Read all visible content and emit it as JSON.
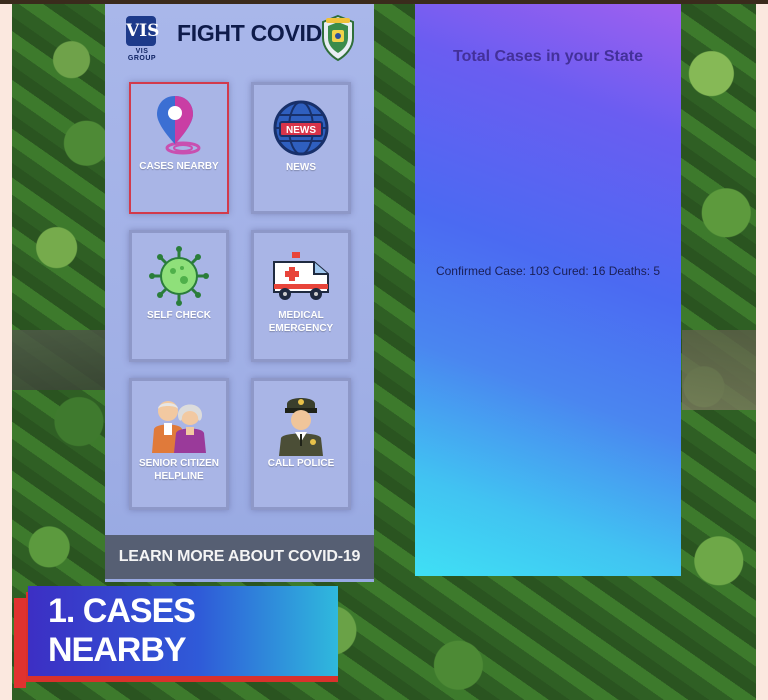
{
  "app": {
    "title": "FIGHT COVID",
    "logo_text": "VIS",
    "logo_sub": "VIS GROUP"
  },
  "tiles": [
    {
      "label": "CASES NEARBY",
      "icon": "location-pin-icon",
      "selected": true
    },
    {
      "label": "NEWS",
      "icon": "news-globe-icon",
      "selected": false
    },
    {
      "label": "SELF CHECK",
      "icon": "virus-icon",
      "selected": false
    },
    {
      "label": "MEDICAL EMERGENCY",
      "icon": "ambulance-icon",
      "selected": false
    },
    {
      "label": "SENIOR CITIZEN HELPLINE",
      "icon": "elderly-couple-icon",
      "selected": false
    },
    {
      "label": "CALL POLICE",
      "icon": "police-officer-icon",
      "selected": false
    }
  ],
  "footer": {
    "learn_more_label": "LEARN MORE ABOUT COVID-19"
  },
  "stats": {
    "title": "Total Cases in your State",
    "summary": "Confirmed Case: 103 Cured: 16 Deaths: 5"
  },
  "caption": {
    "text": "1. CASES NEARBY"
  },
  "colors": {
    "selected_border": "#d23a4c",
    "footer_bar": "#565f73",
    "caption_accent": "#e0322f"
  }
}
